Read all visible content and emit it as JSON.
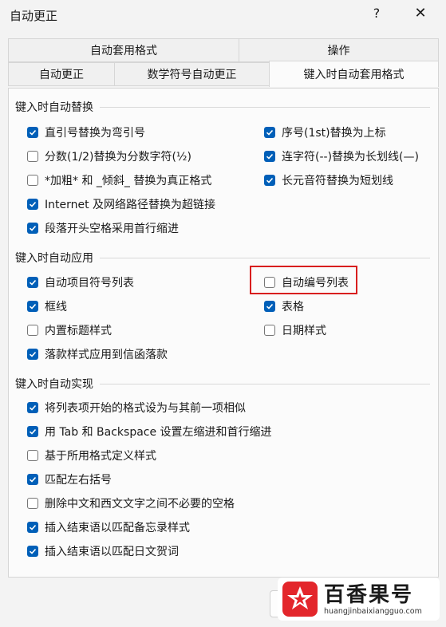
{
  "window": {
    "title": "自动更正",
    "help_glyph": "?",
    "close_glyph": "✕"
  },
  "tabs_row1": [
    "自动套用格式",
    "操作"
  ],
  "tabs_row2": [
    "自动更正",
    "数学符号自动更正",
    "键入时自动套用格式"
  ],
  "active_tab": "键入时自动套用格式",
  "groups": {
    "replace": {
      "title": "键入时自动替换",
      "items": [
        {
          "label": "直引号替换为弯引号",
          "checked": true
        },
        {
          "label": "序号(1st)替换为上标",
          "checked": true
        },
        {
          "label": "分数(1/2)替换为分数字符(½)",
          "checked": false
        },
        {
          "label": "连字符(--)替换为长划线(—)",
          "checked": true
        },
        {
          "label": "*加粗* 和 _倾斜_ 替换为真正格式",
          "checked": false
        },
        {
          "label": "长元音符替换为短划线",
          "checked": true
        },
        {
          "label": "Internet 及网络路径替换为超链接",
          "checked": true
        },
        {
          "label": "段落开头空格采用首行缩进",
          "checked": true
        }
      ]
    },
    "apply": {
      "title": "键入时自动应用",
      "items": [
        {
          "label": "自动项目符号列表",
          "checked": true
        },
        {
          "label": "自动编号列表",
          "checked": false
        },
        {
          "label": "框线",
          "checked": true
        },
        {
          "label": "表格",
          "checked": true
        },
        {
          "label": "内置标题样式",
          "checked": false
        },
        {
          "label": "日期样式",
          "checked": false
        },
        {
          "label": "落款样式应用到信函落款",
          "checked": true
        }
      ]
    },
    "implement": {
      "title": "键入时自动实现",
      "items": [
        {
          "label": "将列表项开始的格式设为与其前一项相似",
          "checked": true
        },
        {
          "label": "用 Tab 和 Backspace 设置左缩进和首行缩进",
          "checked": true
        },
        {
          "label": "基于所用格式定义样式",
          "checked": false
        },
        {
          "label": "匹配左右括号",
          "checked": true
        },
        {
          "label": "删除中文和西文文字之间不必要的空格",
          "checked": false
        },
        {
          "label": "插入结束语以匹配备忘录样式",
          "checked": true
        },
        {
          "label": "插入结束语以匹配日文贺词",
          "checked": true
        }
      ]
    }
  },
  "watermark": {
    "name": "百香果号",
    "url": "huangjinbaixiangguo.com"
  },
  "colors": {
    "accent": "#005fb8",
    "highlight": "#d81e1e"
  }
}
